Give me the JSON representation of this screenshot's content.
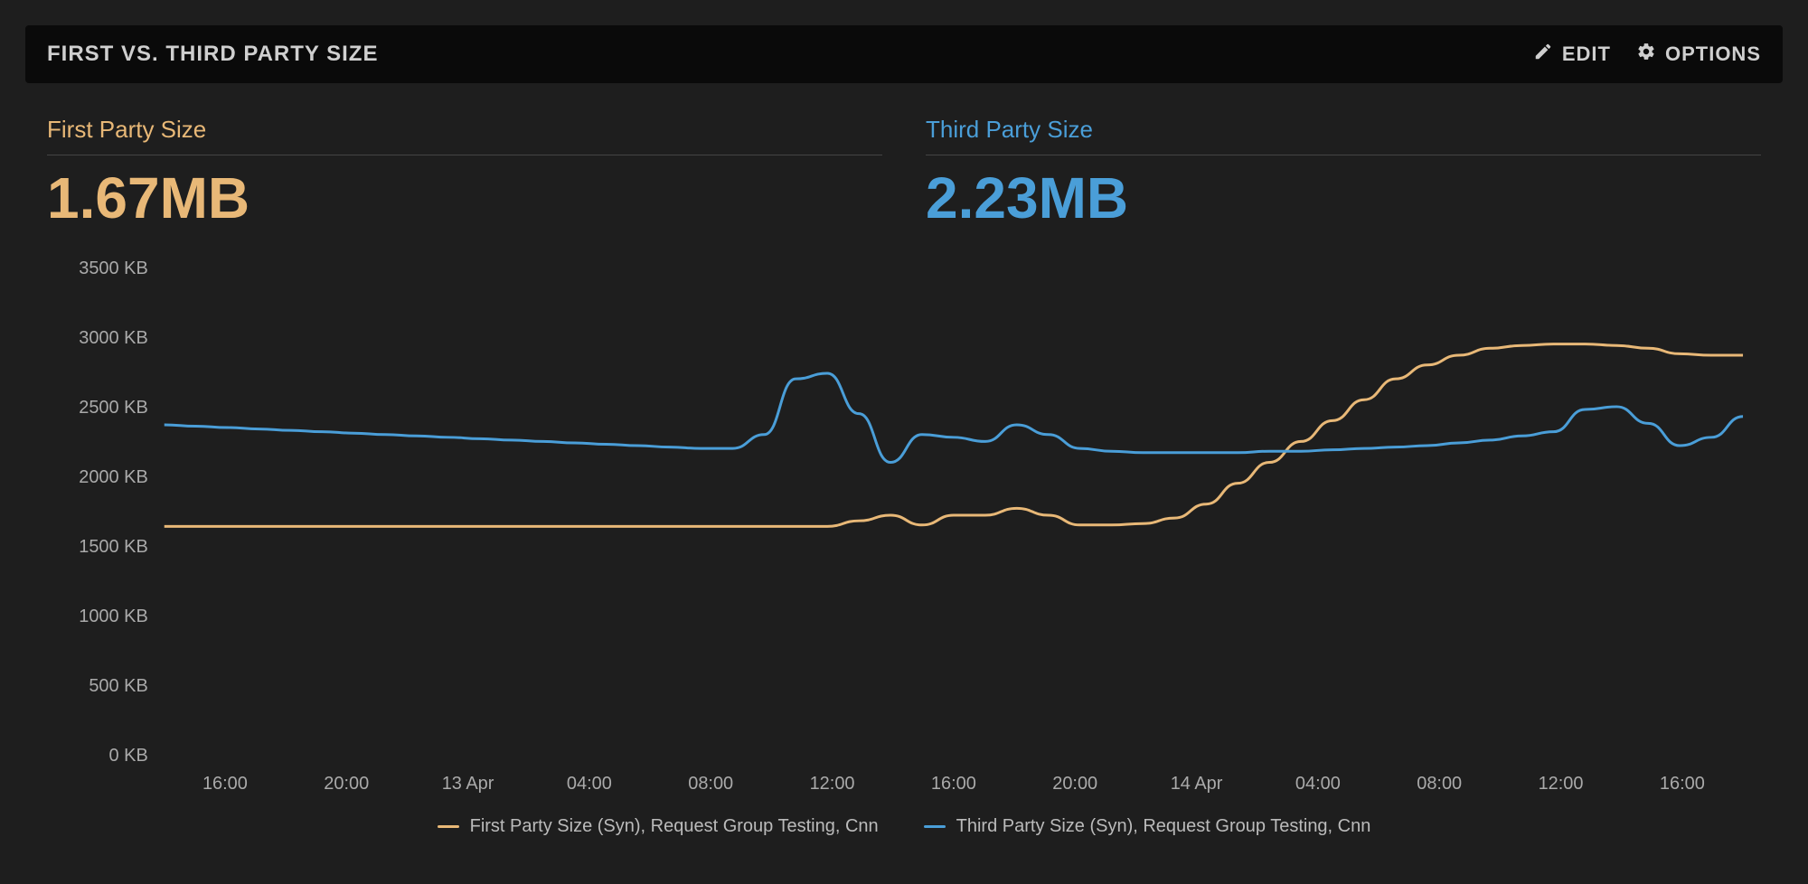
{
  "header": {
    "title": "FIRST VS. THIRD PARTY SIZE",
    "edit_label": "EDIT",
    "options_label": "OPTIONS"
  },
  "metrics": {
    "first_party": {
      "label": "First Party Size",
      "value": "1.67MB"
    },
    "third_party": {
      "label": "Third Party Size",
      "value": "2.23MB"
    }
  },
  "legend": {
    "first": "First Party Size (Syn), Request Group Testing, Cnn",
    "third": "Third Party Size (Syn), Request Group Testing, Cnn"
  },
  "colors": {
    "first": "#e8b877",
    "third": "#4a9ed8"
  },
  "chart_data": {
    "type": "line",
    "title": "First vs. Third Party Size",
    "xlabel": "",
    "ylabel": "KB",
    "ylim": [
      0,
      3500
    ],
    "x_ticks": [
      "16:00",
      "20:00",
      "13 Apr",
      "04:00",
      "08:00",
      "12:00",
      "16:00",
      "20:00",
      "14 Apr",
      "04:00",
      "08:00",
      "12:00",
      "16:00"
    ],
    "y_ticks": [
      "0 KB",
      "500 KB",
      "1000 KB",
      "1500 KB",
      "2000 KB",
      "2500 KB",
      "3000 KB",
      "3500 KB"
    ],
    "y_tick_values": [
      0,
      500,
      1000,
      1500,
      2000,
      2500,
      3000,
      3500
    ],
    "series": [
      {
        "name": "First Party Size (Syn), Request Group Testing, Cnn",
        "color": "#e8b877",
        "values": [
          1640,
          1640,
          1640,
          1640,
          1640,
          1640,
          1640,
          1640,
          1640,
          1640,
          1640,
          1640,
          1640,
          1640,
          1640,
          1640,
          1640,
          1640,
          1640,
          1640,
          1640,
          1640,
          1680,
          1720,
          1650,
          1720,
          1720,
          1770,
          1720,
          1650,
          1650,
          1660,
          1700,
          1800,
          1950,
          2100,
          2250,
          2400,
          2550,
          2700,
          2800,
          2870,
          2920,
          2940,
          2950,
          2950,
          2940,
          2920,
          2880,
          2870,
          2870
        ]
      },
      {
        "name": "Third Party Size (Syn), Request Group Testing, Cnn",
        "color": "#4a9ed8",
        "values": [
          2370,
          2360,
          2350,
          2340,
          2330,
          2320,
          2310,
          2300,
          2290,
          2280,
          2270,
          2260,
          2250,
          2240,
          2230,
          2220,
          2210,
          2200,
          2200,
          2300,
          2700,
          2740,
          2450,
          2100,
          2300,
          2280,
          2250,
          2370,
          2300,
          2200,
          2180,
          2170,
          2170,
          2170,
          2170,
          2180,
          2180,
          2190,
          2200,
          2210,
          2220,
          2240,
          2260,
          2290,
          2320,
          2480,
          2500,
          2380,
          2220,
          2280,
          2430
        ]
      }
    ]
  }
}
